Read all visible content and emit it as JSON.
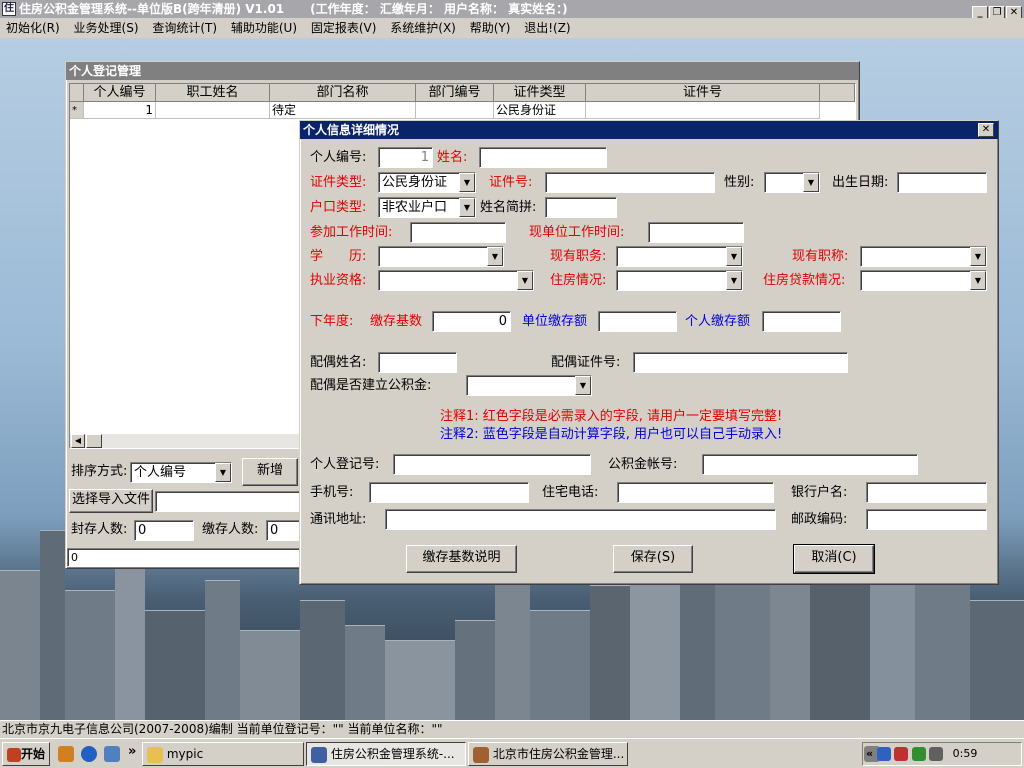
{
  "app": {
    "title": "住房公积金管理系统--单位版B(跨年清册) V1.01",
    "info": "(工作年度：  汇缴年月：  用户名称：  真实姓名：)",
    "minimize": "_",
    "restore": "❐",
    "close": "✕",
    "app_icon": "住"
  },
  "menu": [
    "初始化(R)",
    "业务处理(S)",
    "查询统计(T)",
    "辅助功能(U)",
    "固定报表(V)",
    "系统维护(X)",
    "帮助(Y)",
    "退出!(Z)"
  ],
  "registration": {
    "title": "个人登记管理",
    "columns": [
      "个人编号",
      "职工姓名",
      "部门名称",
      "部门编号",
      "证件类型",
      "证件号"
    ],
    "row": {
      "marker": "*",
      "id": "1",
      "name": "",
      "dept": "待定",
      "dept_no": "",
      "id_type": "公民身份证",
      "id_no": ""
    },
    "sort_label": "排序方式:",
    "sort_value": "个人编号",
    "add_button": "新增",
    "import_button": "选择导入文件",
    "sealed_label": "封存人数:",
    "sealed_value": "0",
    "paying_label": "缴存人数:",
    "paying_value": "0",
    "bottom_value": "0"
  },
  "dialog": {
    "title": "个人信息详细情况",
    "close": "✕",
    "labels": {
      "person_no": "个人编号:",
      "name": "姓名:",
      "id_type": "证件类型:",
      "id_no": "证件号:",
      "gender": "性别:",
      "birth": "出生日期:",
      "hukou": "户口类型:",
      "name_py": "姓名简拼:",
      "work_start": "参加工作时间:",
      "cur_work": "现单位工作时间:",
      "edu": "学　　历:",
      "duty": "现有职务:",
      "title": "现有职称:",
      "qual": "执业资格:",
      "housing": "住房情况:",
      "loan": "住房贷款情况:",
      "next_year": "下年度:",
      "base": "缴存基数",
      "unit_amt": "单位缴存额",
      "person_amt": "个人缴存额",
      "spouse_name": "配偶姓名:",
      "spouse_id": "配偶证件号:",
      "spouse_fund": "配偶是否建立公积金:",
      "reg_no": "个人登记号:",
      "fund_acct": "公积金帐号:",
      "mobile": "手机号:",
      "home_phone": "住宅电话:",
      "bank_name": "银行户名:",
      "address": "通讯地址:",
      "postcode": "邮政编码:"
    },
    "values": {
      "person_no": "1",
      "id_type": "公民身份证",
      "hukou": "非农业户口",
      "base": "0"
    },
    "note1": "注释1: 红色字段是必需录入的字段, 请用户一定要填写完整!",
    "note2": "注释2: 蓝色字段是自动计算字段, 用户也可以自己手动录入!",
    "buttons": {
      "base_help": "缴存基数说明",
      "save": "保存(S)",
      "cancel": "取消(C)"
    }
  },
  "statusbar": "北京市京九电子信息公司(2007-2008)编制   当前单位登记号：\"\"  当前单位名称：\"\"",
  "taskbar": {
    "start": "开始",
    "chevron": "»",
    "items": [
      "mypic",
      "住房公积金管理系统-...",
      "北京市住房公积金管理..."
    ],
    "tray_chevron": "«",
    "clock": "0:59"
  }
}
